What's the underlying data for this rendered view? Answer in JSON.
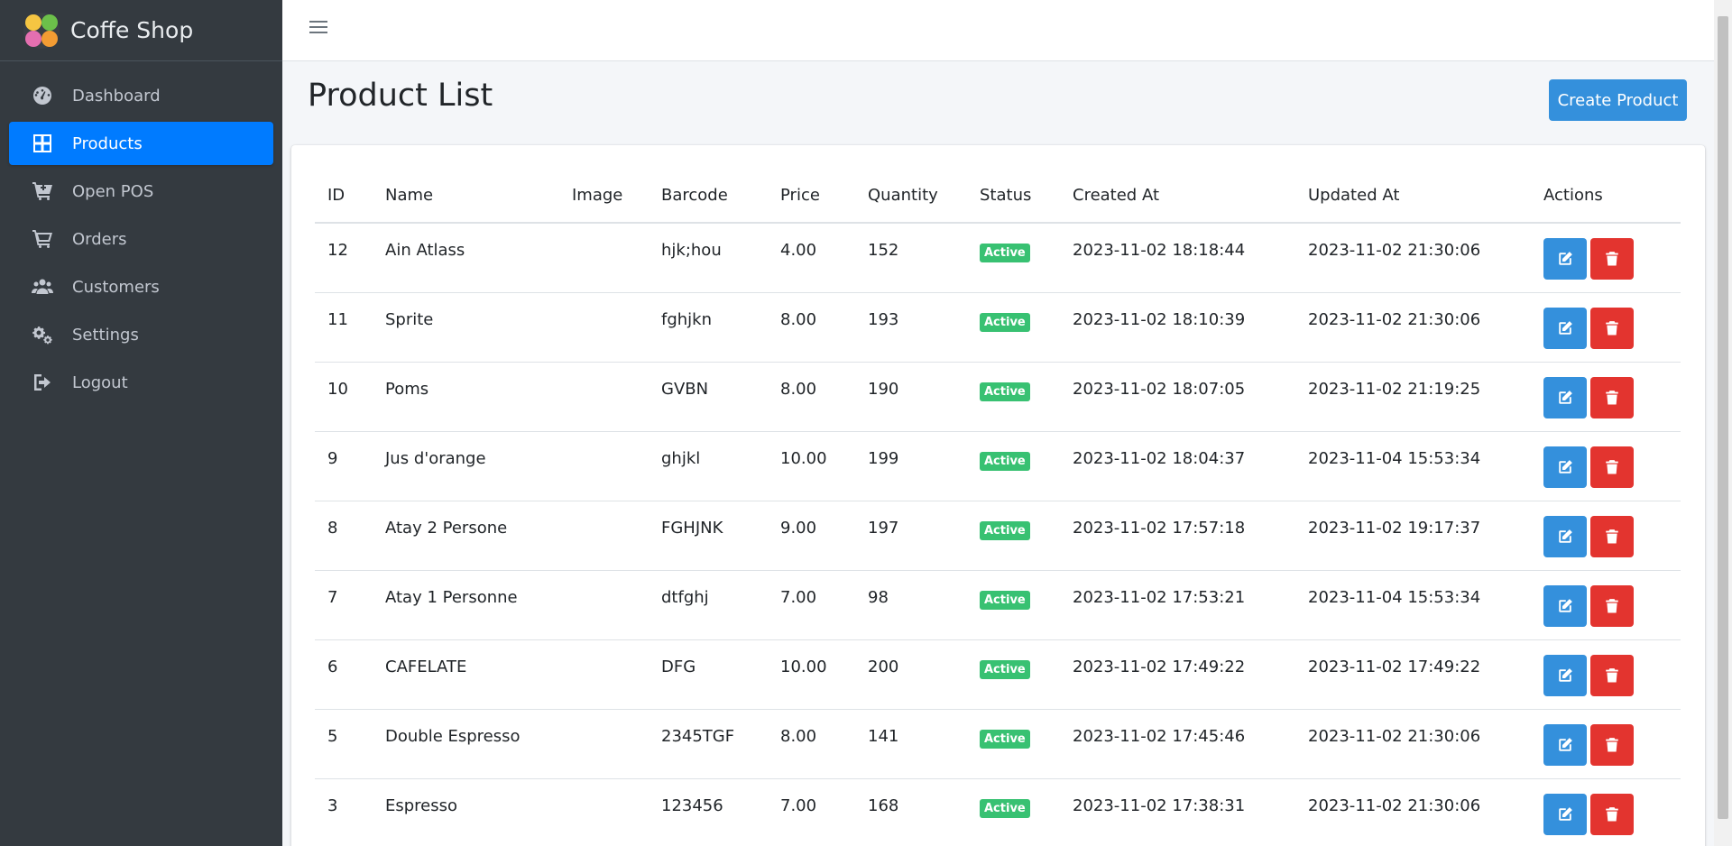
{
  "brand": {
    "title": "Coffe Shop"
  },
  "sidebar": {
    "items": [
      {
        "label": "Dashboard",
        "icon": "tachometer-icon",
        "active": false
      },
      {
        "label": "Products",
        "icon": "grid-icon",
        "active": true
      },
      {
        "label": "Open POS",
        "icon": "cart-plus-icon",
        "active": false
      },
      {
        "label": "Orders",
        "icon": "cart-icon",
        "active": false
      },
      {
        "label": "Customers",
        "icon": "users-icon",
        "active": false
      },
      {
        "label": "Settings",
        "icon": "cogs-icon",
        "active": false
      },
      {
        "label": "Logout",
        "icon": "sign-out-icon",
        "active": false
      }
    ]
  },
  "page": {
    "title": "Product List",
    "create_button": "Create Product"
  },
  "table": {
    "headers": [
      "ID",
      "Name",
      "Image",
      "Barcode",
      "Price",
      "Quantity",
      "Status",
      "Created At",
      "Updated At",
      "Actions"
    ],
    "rows": [
      {
        "id": "12",
        "name": "Ain Atlass",
        "image": "",
        "barcode": "hjk;hou",
        "price": "4.00",
        "quantity": "152",
        "status": "Active",
        "created_at": "2023-11-02 18:18:44",
        "updated_at": "2023-11-02 21:30:06"
      },
      {
        "id": "11",
        "name": "Sprite",
        "image": "",
        "barcode": "fghjkn",
        "price": "8.00",
        "quantity": "193",
        "status": "Active",
        "created_at": "2023-11-02 18:10:39",
        "updated_at": "2023-11-02 21:30:06"
      },
      {
        "id": "10",
        "name": "Poms",
        "image": "",
        "barcode": "GVBN",
        "price": "8.00",
        "quantity": "190",
        "status": "Active",
        "created_at": "2023-11-02 18:07:05",
        "updated_at": "2023-11-02 21:19:25"
      },
      {
        "id": "9",
        "name": "Jus d'orange",
        "image": "",
        "barcode": "ghjkl",
        "price": "10.00",
        "quantity": "199",
        "status": "Active",
        "created_at": "2023-11-02 18:04:37",
        "updated_at": "2023-11-04 15:53:34"
      },
      {
        "id": "8",
        "name": "Atay 2 Persone",
        "image": "",
        "barcode": "FGHJNK",
        "price": "9.00",
        "quantity": "197",
        "status": "Active",
        "created_at": "2023-11-02 17:57:18",
        "updated_at": "2023-11-02 19:17:37"
      },
      {
        "id": "7",
        "name": "Atay 1 Personne",
        "image": "",
        "barcode": "dtfghj",
        "price": "7.00",
        "quantity": "98",
        "status": "Active",
        "created_at": "2023-11-02 17:53:21",
        "updated_at": "2023-11-04 15:53:34"
      },
      {
        "id": "6",
        "name": "CAFELATE",
        "image": "",
        "barcode": "DFG",
        "price": "10.00",
        "quantity": "200",
        "status": "Active",
        "created_at": "2023-11-02 17:49:22",
        "updated_at": "2023-11-02 17:49:22"
      },
      {
        "id": "5",
        "name": "Double Espresso",
        "image": "",
        "barcode": "2345TGF",
        "price": "8.00",
        "quantity": "141",
        "status": "Active",
        "created_at": "2023-11-02 17:45:46",
        "updated_at": "2023-11-02 21:30:06"
      },
      {
        "id": "3",
        "name": "Espresso",
        "image": "",
        "barcode": "123456",
        "price": "7.00",
        "quantity": "168",
        "status": "Active",
        "created_at": "2023-11-02 17:38:31",
        "updated_at": "2023-11-02 21:30:06"
      }
    ]
  },
  "colors": {
    "sidebar_bg": "#343a40",
    "active_nav": "#007bff",
    "primary": "#3490dc",
    "danger": "#e3342f",
    "success": "#38c172"
  }
}
